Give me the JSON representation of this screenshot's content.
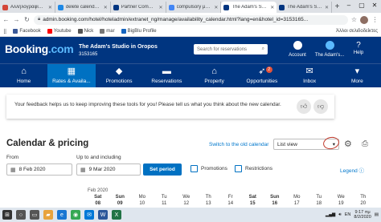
{
  "browser": {
    "tabs": [
      {
        "title": "Αλληλογραφία - ...",
        "color": "#d44638",
        "active": false
      },
      {
        "title": "delete calendars |",
        "color": "#1e88e5",
        "active": false
      },
      {
        "title": "Partner Communi",
        "color": "#003580",
        "active": false
      },
      {
        "title": "compulsory μεταφ",
        "color": "#4285f4",
        "active": false
      },
      {
        "title": "The Adam's Studio",
        "color": "#003580",
        "active": true
      },
      {
        "title": "The Adam's Studio",
        "color": "#003580",
        "active": false
      }
    ],
    "url": "admin.booking.com/hotel/hoteladmin/extranet_ng/manage/availability_calendar.html?lang=en&hotel_id=3153165...",
    "bookmarks": [
      {
        "label": "Facebook",
        "color": "#3b5998"
      },
      {
        "label": "Youtube",
        "color": "#ff0000"
      },
      {
        "label": "Nick",
        "color": "#555555"
      },
      {
        "label": "mar",
        "color": "#777777"
      },
      {
        "label": "BigBlu Profile",
        "color": "#1565c0"
      }
    ],
    "other_bookmarks": "Άλλοι σελιδοδείκτες"
  },
  "header": {
    "logo_main": "Booking",
    "logo_dot": ".com",
    "property_name": "The Adam's Studio in Oropos",
    "property_id": "3153165",
    "search_placeholder": "Search for reservations",
    "account_label": "Account",
    "studio_label": "The Adam's...",
    "help_label": "Help"
  },
  "nav": [
    {
      "label": "Home",
      "icon": "home-icon",
      "glyph": "⌂",
      "active": false
    },
    {
      "label": "Rates & Availa...",
      "icon": "calendar-icon",
      "glyph": "▦",
      "active": true
    },
    {
      "label": "Promotions",
      "icon": "tag-icon",
      "glyph": "◆",
      "active": false
    },
    {
      "label": "Reservations",
      "icon": "bed-icon",
      "glyph": "▬",
      "active": false
    },
    {
      "label": "Property",
      "icon": "house-icon",
      "glyph": "⌂",
      "active": false
    },
    {
      "label": "Opportunities",
      "icon": "rocket-icon",
      "glyph": "➶",
      "active": false,
      "badge": "2"
    },
    {
      "label": "Inbox",
      "icon": "mail-icon",
      "glyph": "✉",
      "active": false
    },
    {
      "label": "More",
      "icon": "chevron-down-icon",
      "glyph": "▾",
      "active": false
    }
  ],
  "feedback": {
    "text": "Your feedback helps us to keep improving these tools for you! Please tell us what you think about the new calendar."
  },
  "calendar": {
    "title": "Calendar & pricing",
    "switch_link": "Switch to the old calendar",
    "view": "List view",
    "from_label": "From",
    "from_value": "8 Feb 2020",
    "to_label": "Up to and including",
    "to_value": "9 Mar 2020",
    "set_period": "Set period",
    "promotions_label": "Promotions",
    "restrictions_label": "Restrictions",
    "legend_label": "Legend",
    "month": "Feb 2020",
    "days": [
      {
        "name": "Sat",
        "date": "08",
        "weekend": true
      },
      {
        "name": "Sun",
        "date": "09",
        "weekend": true
      },
      {
        "name": "Mo",
        "date": "10",
        "weekend": false
      },
      {
        "name": "Tu",
        "date": "11",
        "weekend": false
      },
      {
        "name": "We",
        "date": "12",
        "weekend": false
      },
      {
        "name": "Th",
        "date": "13",
        "weekend": false
      },
      {
        "name": "Fr",
        "date": "14",
        "weekend": false
      },
      {
        "name": "Sat",
        "date": "15",
        "weekend": true
      },
      {
        "name": "Sun",
        "date": "16",
        "weekend": true
      },
      {
        "name": "Mo",
        "date": "17",
        "weekend": false
      },
      {
        "name": "Tu",
        "date": "18",
        "weekend": false
      },
      {
        "name": "We",
        "date": "19",
        "weekend": false
      },
      {
        "name": "Th",
        "date": "20",
        "weekend": false
      }
    ]
  },
  "taskbar": {
    "apps": [
      {
        "icon": "windows-start-icon",
        "glyph": "⊞",
        "color": "#333333"
      },
      {
        "icon": "search-icon",
        "glyph": "○",
        "color": "#555555"
      },
      {
        "icon": "task-view-icon",
        "glyph": "▭",
        "color": "#555555"
      },
      {
        "icon": "file-explorer-icon",
        "glyph": "▰",
        "color": "#e8a33d"
      },
      {
        "icon": "edge-icon",
        "glyph": "e",
        "color": "#1976d2"
      },
      {
        "icon": "chrome-icon",
        "glyph": "◉",
        "color": "#34a853"
      },
      {
        "icon": "mail-icon",
        "glyph": "✉",
        "color": "#0078d7"
      },
      {
        "icon": "word-icon",
        "glyph": "W",
        "color": "#2b579a"
      },
      {
        "icon": "excel-icon",
        "glyph": "X",
        "color": "#217346"
      }
    ],
    "lang": "EN",
    "time": "9:17 πμ",
    "date": "8/2/2020"
  }
}
